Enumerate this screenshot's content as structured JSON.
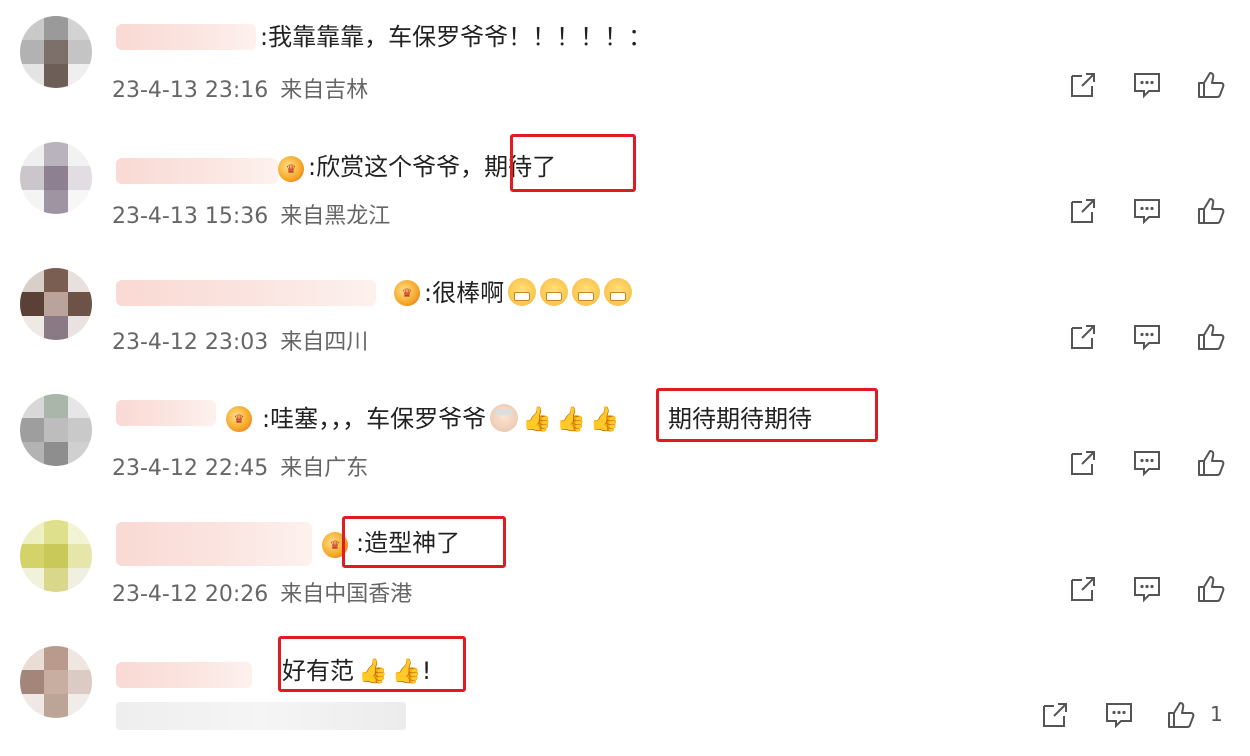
{
  "comments": [
    {
      "text": ":我靠靠靠，车保罗爷爷！！！！！：",
      "date": "23-4-13 23:16",
      "location": "来自吉林"
    },
    {
      "text": ":欣赏这个爷爷，期待了",
      "date": "23-4-13 15:36",
      "location": "来自黑龙江"
    },
    {
      "text": ":很棒啊",
      "date": "23-4-12 23:03",
      "location": "来自四川"
    },
    {
      "text": ":哇塞，，，车保罗爷爷",
      "text2": "期待期待期待",
      "date": "23-4-12 22:45",
      "location": "来自广东"
    },
    {
      "text": ":造型神了",
      "date": "23-4-12 20:26",
      "location": "来自中国香港"
    },
    {
      "text": "好有范",
      "text2": "!",
      "date": "",
      "location": ""
    }
  ],
  "last_like_count": "1",
  "icons": [
    "share-icon",
    "comment-icon",
    "like-icon"
  ],
  "colors": {
    "highlight": "#e11b22",
    "meta_text": "#666666"
  }
}
